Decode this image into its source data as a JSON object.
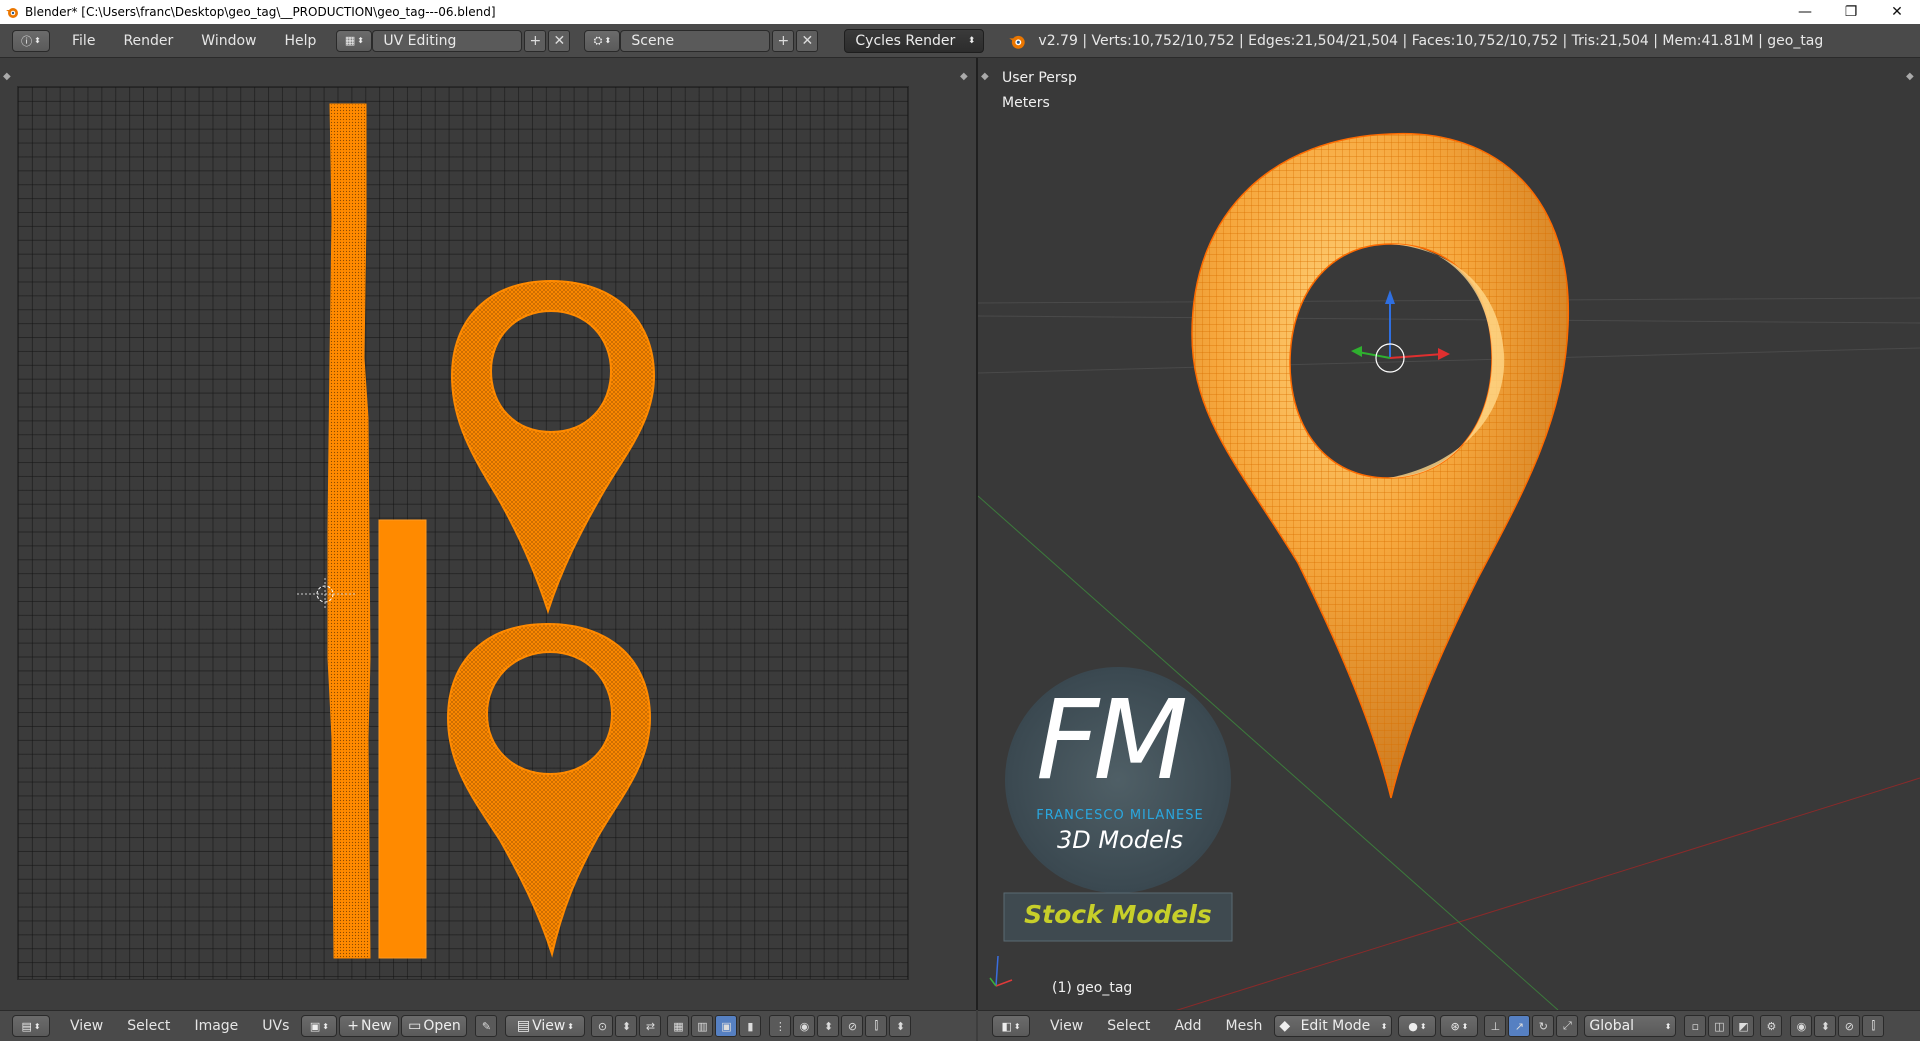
{
  "window": {
    "title": "Blender* [C:\\Users\\franc\\Desktop\\geo_tag\\__PRODUCTION\\geo_tag---06.blend]",
    "minimize": "—",
    "maximize": "❐",
    "close": "✕"
  },
  "info_header": {
    "menu": [
      "File",
      "Render",
      "Window",
      "Help"
    ],
    "screen_layout": "UV Editing",
    "scene": "Scene",
    "render_engine": "Cycles Render",
    "stats": "v2.79 | Verts:10,752/10,752 | Edges:21,504/21,504 | Faces:10,752/10,752 | Tris:21,504 | Mem:41.81M | geo_tag"
  },
  "viewport": {
    "view_name": "User Persp",
    "units": "Meters",
    "object_label": "(1) geo_tag"
  },
  "uv_header": {
    "menu": [
      "View",
      "Select",
      "Image",
      "UVs"
    ],
    "new_label": "New",
    "open_label": "Open",
    "view_label": "View"
  },
  "view3d_header": {
    "menu": [
      "View",
      "Select",
      "Add",
      "Mesh"
    ],
    "mode": "Edit Mode",
    "orientation": "Global"
  },
  "watermark": {
    "logo_letters": "FM",
    "company": "FRANCESCO MILANESE",
    "tagline": "3D Models",
    "stock": "Stock Models"
  },
  "colors": {
    "accent_orange": "#ff8a00",
    "mesh_light": "#f4b24a",
    "fm_blue": "#2aa7df",
    "stock_yellow": "#c7cf2a"
  }
}
